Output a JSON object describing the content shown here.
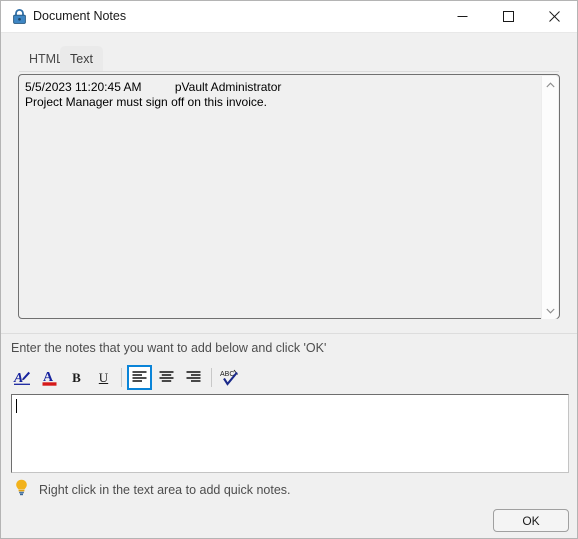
{
  "window": {
    "title": "Document Notes",
    "icon": "lock-icon",
    "controls": {
      "minimize": "minimize-icon",
      "maximize": "maximize-icon",
      "close": "close-icon"
    }
  },
  "tabs": [
    {
      "label": "HTML",
      "active": false
    },
    {
      "label": "Text",
      "active": true
    }
  ],
  "notes": {
    "content": "5/5/2023 11:20:45 AM          pVault Administrator\nProject Manager must sign off on this invoice.",
    "entries": [
      {
        "timestamp": "5/5/2023 11:20:45 AM",
        "author": "pVault Administrator",
        "body": "Project Manager must sign off on this invoice."
      }
    ],
    "scrollbar": {
      "up_arrow": "chevron-up-icon",
      "down_arrow": "chevron-down-icon"
    }
  },
  "instruction": "Enter the notes that you want to add below and click 'OK'",
  "toolbar": {
    "items": [
      {
        "name": "font-dialog-button",
        "icon": "font-a-pen-icon",
        "label": "A",
        "selected": false
      },
      {
        "name": "font-color-button",
        "icon": "font-color-a-icon",
        "label": "A",
        "selected": false
      },
      {
        "name": "bold-button",
        "icon": "bold-icon",
        "label": "B",
        "selected": false
      },
      {
        "name": "underline-button",
        "icon": "underline-icon",
        "label": "U",
        "selected": false
      },
      {
        "name": "align-left-button",
        "icon": "align-left-icon",
        "label": "",
        "selected": true
      },
      {
        "name": "align-center-button",
        "icon": "align-center-icon",
        "label": "",
        "selected": false
      },
      {
        "name": "align-right-button",
        "icon": "align-right-icon",
        "label": "",
        "selected": false
      },
      {
        "name": "spellcheck-button",
        "icon": "spellcheck-abc-icon",
        "label": "",
        "selected": false
      }
    ],
    "font_color_swatch": "#d61a1a",
    "selected_highlight_color": "#0a84d8"
  },
  "editor": {
    "value": "",
    "placeholder": ""
  },
  "hint": {
    "icon": "lightbulb-icon",
    "text": "Right click in the text area to add quick notes.",
    "icon_color": "#f2b21c"
  },
  "buttons": {
    "ok_label": "OK"
  }
}
